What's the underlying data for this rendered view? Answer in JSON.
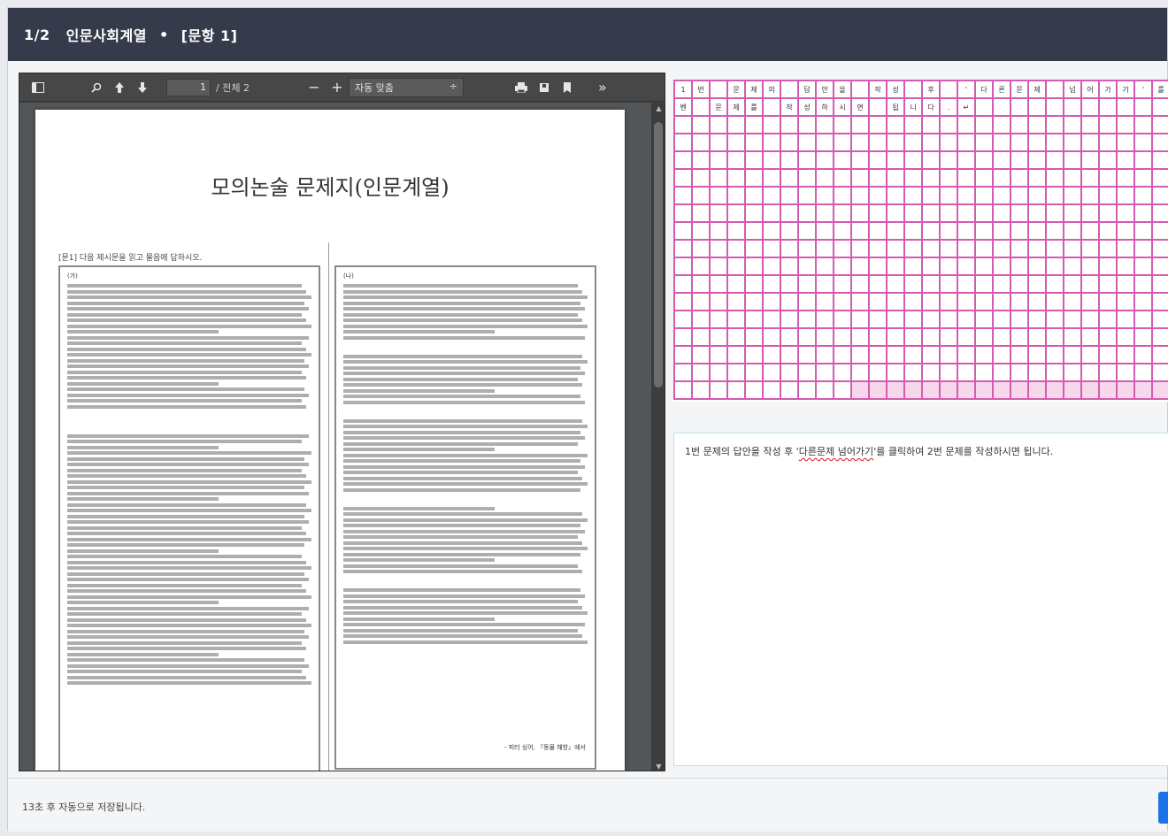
{
  "header": {
    "page_indicator": "1/2",
    "category": "인문사회계열",
    "separator": "•",
    "question_label": "[문항 1]"
  },
  "viewer": {
    "toolbar": {
      "sidebar_icon": "sidebar-icon",
      "search_icon": "search-icon",
      "prev_icon": "arrow-up-icon",
      "next_icon": "arrow-down-icon",
      "page_value": "1",
      "page_total": "/ 전체 2",
      "zoom_out": "−",
      "zoom_in": "+",
      "zoom_value": "자동 맞춤",
      "zoom_caret": "÷",
      "tools_label": "»"
    },
    "document": {
      "title": "모의논술 문제지(인문계열)",
      "instruction": "[문1] 다음 제시문을 읽고 물음에 답하시오.",
      "passage_a_tag": "(가)",
      "passage_b_tag": "(나)",
      "passage_b_attribution": "- 피터 싱어, 『동물 해방』에서"
    }
  },
  "answer_grid": {
    "columns": 29,
    "rows": 18,
    "row1": [
      "1",
      "번",
      "",
      "문",
      "제",
      "의",
      "",
      "답",
      "안",
      "을",
      "",
      "작",
      "성",
      "",
      "후",
      "",
      "'",
      "다",
      "른",
      "문",
      "제",
      "",
      "넘",
      "어",
      "가",
      "기",
      "'",
      "를",
      ""
    ],
    "row2": [
      "벤",
      "",
      "문",
      "제",
      "를",
      "",
      "작",
      "성",
      "하",
      "시",
      "면",
      "",
      "됩",
      "니",
      "다",
      ".",
      "↵",
      "",
      "",
      "",
      "",
      "",
      "",
      "",
      "",
      "",
      "",
      "",
      ""
    ]
  },
  "text_panel": {
    "prefix": "1번 문제의 답안을 작성 후 '",
    "highlight": "다른문제 넘어가기",
    "suffix": "'를 클릭하여 2번 문제를 작성하시면 됩니다."
  },
  "footer": {
    "autosave_status": "13초 후 자동으로 저장됩니다."
  }
}
